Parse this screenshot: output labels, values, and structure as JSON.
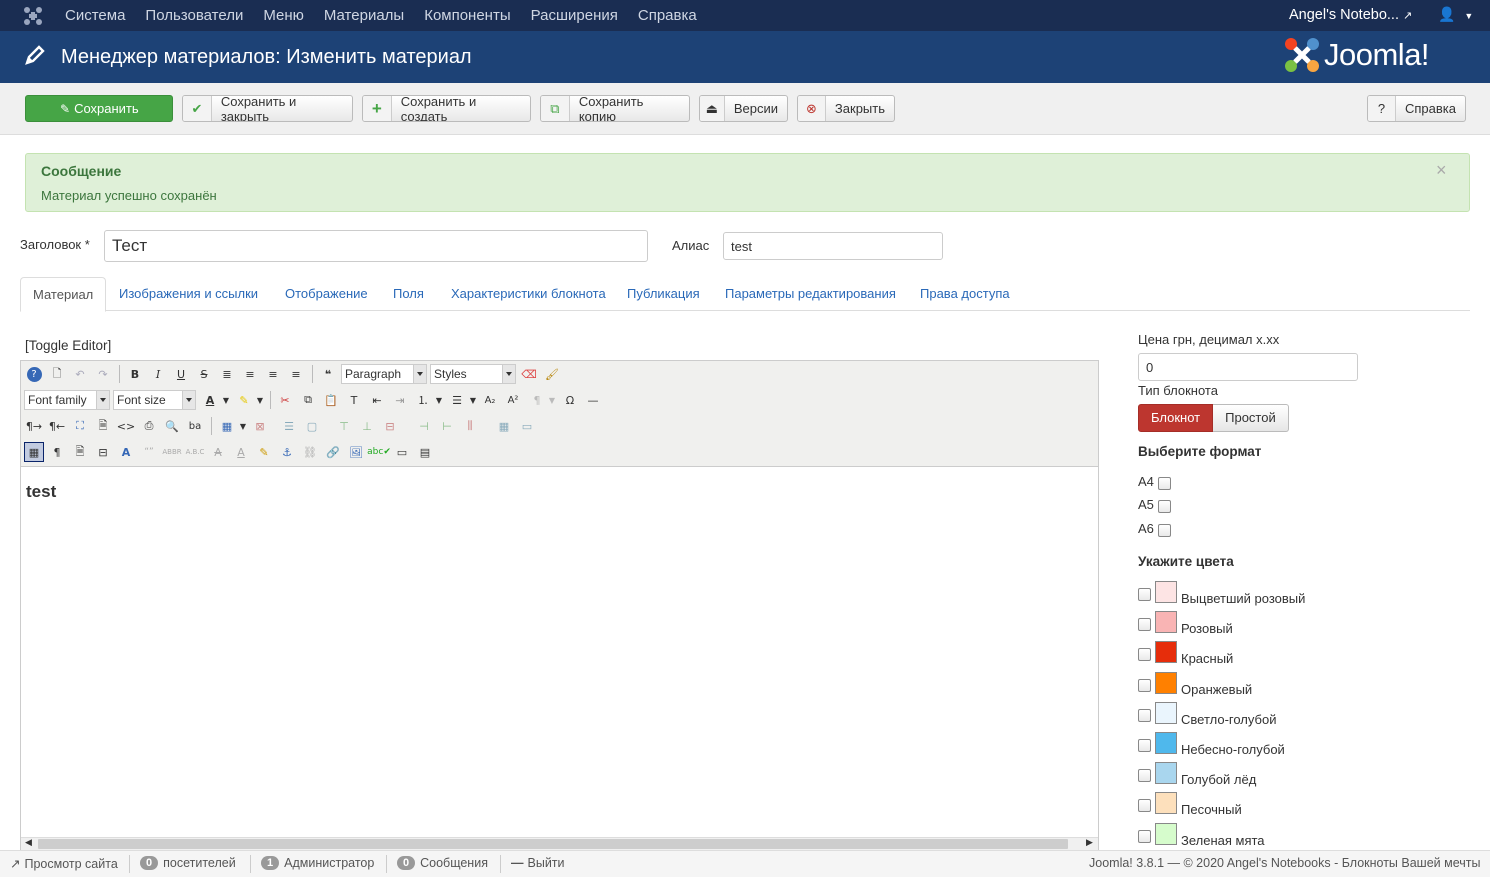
{
  "topnav": {
    "menu": [
      "Система",
      "Пользователи",
      "Меню",
      "Материалы",
      "Компоненты",
      "Расширения",
      "Справка"
    ],
    "site_name": "Angel's Notebo...",
    "user_icon": "user-icon"
  },
  "header": {
    "title": "Менеджер материалов: Изменить материал",
    "brand": "Joomla!"
  },
  "toolbar": {
    "save": "Сохранить",
    "save_close": "Сохранить и закрыть",
    "save_new": "Сохранить и создать",
    "save_copy": "Сохранить копию",
    "versions": "Версии",
    "close": "Закрыть",
    "help": "Справка"
  },
  "message": {
    "title": "Сообщение",
    "body": "Материал успешно сохранён",
    "close": "×"
  },
  "form": {
    "title_label": "Заголовок *",
    "title_value": "Тест",
    "alias_label": "Алиас",
    "alias_value": "test"
  },
  "tabs": [
    "Материал",
    "Изображения и ссылки",
    "Отображение",
    "Поля",
    "Характеристики блокнота",
    "Публикация",
    "Параметры редактирования",
    "Права доступа"
  ],
  "editor": {
    "toggle": "[Toggle Editor]",
    "format_select": "Paragraph",
    "styles_select": "Styles",
    "font_family": "Font family",
    "font_size": "Font size",
    "content": "test"
  },
  "side": {
    "price_label": "Цена грн, децимал x.xx",
    "price_value": "0",
    "type_label": "Тип блокнота",
    "type_options": [
      "Блокнот",
      "Простой"
    ],
    "format_title": "Выберите формат",
    "formats": [
      "A4",
      "A5",
      "A6"
    ],
    "colors_title": "Укажите цвета",
    "colors": [
      {
        "name": "Выцветший розовый",
        "hex": "#fde4e4"
      },
      {
        "name": "Розовый",
        "hex": "#f9b4b4"
      },
      {
        "name": "Красный",
        "hex": "#e62d0b"
      },
      {
        "name": "Оранжевый",
        "hex": "#ff8000"
      },
      {
        "name": "Светло-голубой",
        "hex": "#eaf5fd"
      },
      {
        "name": "Небесно-голубой",
        "hex": "#4fb8ec"
      },
      {
        "name": "Голубой лёд",
        "hex": "#a9d6ee"
      },
      {
        "name": "Песочный",
        "hex": "#fde0bc"
      },
      {
        "name": "Зеленая мята",
        "hex": "#d6fccc"
      }
    ]
  },
  "status": {
    "view_site": "Просмотр сайта",
    "visitors_count": "0",
    "visitors": "посетителей",
    "admins_count": "1",
    "admins": "Администратор",
    "messages_count": "0",
    "messages": "Сообщения",
    "logout": "Выйти",
    "footer": "Joomla! 3.8.1  —  © 2020 Angel's Notebooks - Блокноты Вашей мечты"
  },
  "colors": {
    "accent_blue": "#1d4276",
    "save_green": "#46a546",
    "danger_red": "#bd362f"
  }
}
